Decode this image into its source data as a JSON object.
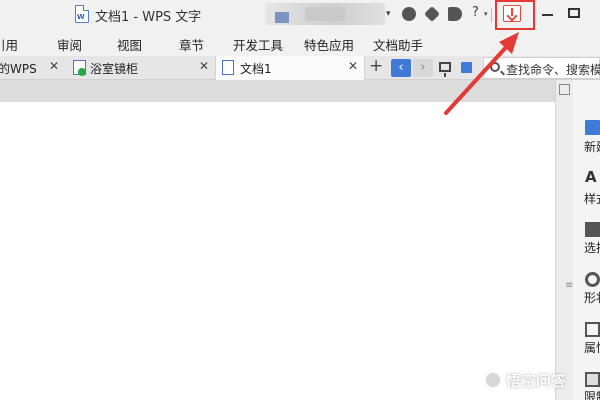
{
  "window": {
    "title": "文档1 - WPS 文字",
    "doc_icon_letter": "W",
    "account_dropdown_glyph": "▾",
    "help_glyph": "?",
    "help_caret_glyph": "▾",
    "icons": [
      "skin-icon",
      "settings-icon",
      "docer-icon",
      "help-icon",
      "download-icon",
      "minimize-icon",
      "maximize-icon"
    ]
  },
  "ribbon": {
    "tabs": [
      "引用",
      "审阅",
      "视图",
      "章节",
      "开发工具",
      "特色应用",
      "文档助手"
    ]
  },
  "doc_tabs": [
    {
      "label": "我的WPS",
      "close": "✕"
    },
    {
      "label": "浴室镜柜",
      "close": "✕"
    },
    {
      "label": "文档1",
      "close": "✕",
      "active": true
    }
  ],
  "tab_controls": {
    "new_tab": "+",
    "back": "‹",
    "forward": "›"
  },
  "search": {
    "placeholder": "查找命令、搜索模板"
  },
  "scrollbar": {
    "grip": "≡"
  },
  "task_panel": {
    "items": [
      {
        "label": "新建",
        "icon": "new-icon"
      },
      {
        "label": "样式",
        "icon": "style-icon",
        "glyph": "A"
      },
      {
        "label": "选择",
        "icon": "select-icon"
      },
      {
        "label": "形状",
        "icon": "shape-icon"
      },
      {
        "label": "属性",
        "icon": "property-icon"
      },
      {
        "label": "限制",
        "icon": "restrict-icon"
      }
    ]
  },
  "annotation": {
    "color": "#e53935"
  },
  "watermark": {
    "text": "悟空问答"
  },
  "colors": {
    "accent": "#3f7ad6",
    "highlight": "#e53935",
    "download": "#e64a3c"
  }
}
